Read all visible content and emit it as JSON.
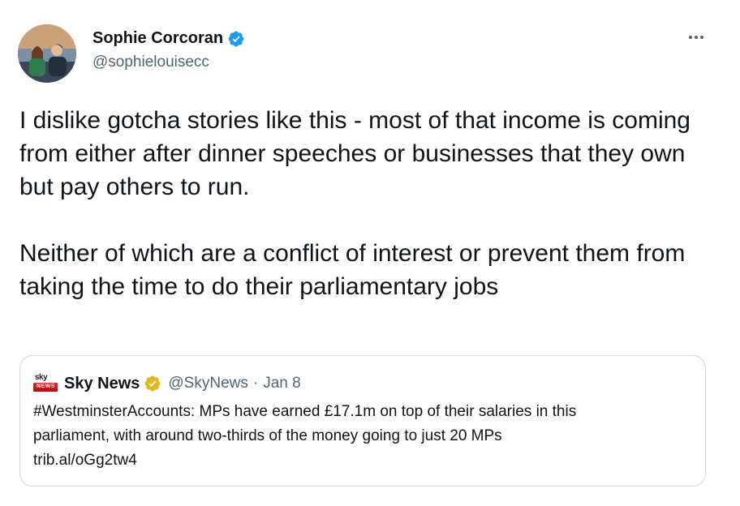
{
  "tweet": {
    "author": {
      "display_name": "Sophie Corcoran",
      "handle": "@sophielouisecc",
      "verified_icon": "blue-verified-check"
    },
    "more_icon": "more-horizontal-icon",
    "paragraphs": [
      "I dislike gotcha stories like this - most of that income is coming from either after dinner speeches or businesses that they own but pay others to run.",
      "Neither of which are a conflict of interest or prevent them from taking the time to do their parliamentary jobs"
    ],
    "quoted": {
      "logo_word": "sky",
      "display_name": "Sky News",
      "verified_icon": "gold-verified-check",
      "handle": "@SkyNews",
      "separator": "·",
      "date": "Jan 8",
      "lines": [
        "#WestminsterAccounts: MPs have earned £17.1m on top of their salaries in this",
        "parliament, with around two-thirds of the money going to just 20 MPs",
        "trib.al/oGg2tw4"
      ]
    }
  },
  "colors": {
    "text": "#0f1419",
    "secondary": "#536471",
    "verified_blue": "#1d9bf0",
    "verified_gold": "#e2b719",
    "border": "#cfd9de",
    "sky_red": "#e52d27"
  }
}
